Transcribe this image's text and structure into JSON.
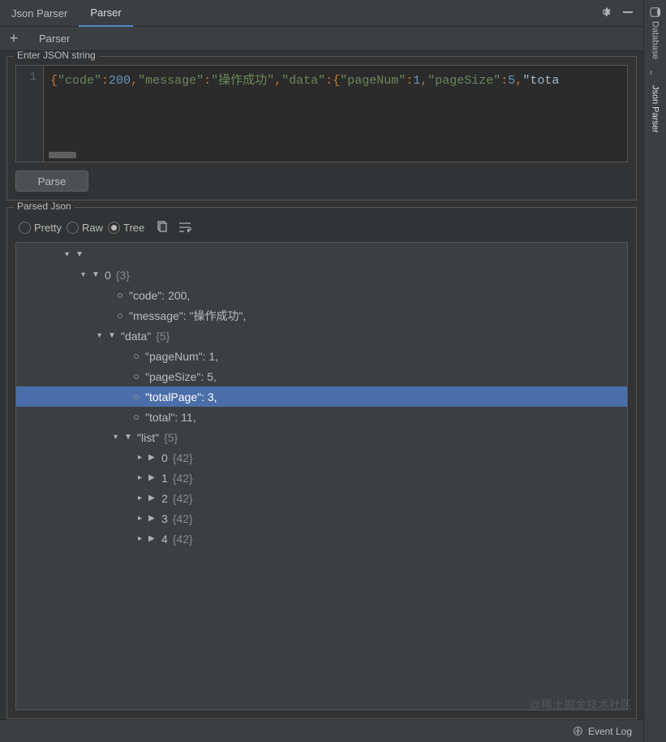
{
  "topbar": {
    "tab_inactive": "Json Parser",
    "tab_active": "Parser"
  },
  "subbar": {
    "plus": "+",
    "tab": "Parser"
  },
  "editor": {
    "fieldset_label": "Enter JSON string",
    "line_number": "1",
    "raw_json": "{\"code\":200,\"message\":\"操作成功\",\"data\":{\"pageNum\":1,\"pageSize\":5,\"tota",
    "parse_button": "Parse"
  },
  "parsed": {
    "fieldset_label": "Parsed Json",
    "view_pretty": "Pretty",
    "view_raw": "Raw",
    "view_tree": "Tree",
    "selected_view": "Tree"
  },
  "tree": [
    {
      "indent": 60,
      "type": "toggle",
      "key": "",
      "count": ""
    },
    {
      "indent": 80,
      "type": "toggle",
      "key": "0",
      "count": "{3}"
    },
    {
      "indent": 125,
      "type": "leaf",
      "key": "\"code\": 200,"
    },
    {
      "indent": 125,
      "type": "leaf",
      "key": "\"message\": \"操作成功\","
    },
    {
      "indent": 100,
      "type": "toggle",
      "key": "\"data\"",
      "count": "{5}"
    },
    {
      "indent": 145,
      "type": "leaf",
      "key": "\"pageNum\": 1,"
    },
    {
      "indent": 145,
      "type": "leaf",
      "key": "\"pageSize\": 5,"
    },
    {
      "indent": 145,
      "type": "leaf",
      "key": "\"totalPage\": 3,",
      "selected": true
    },
    {
      "indent": 145,
      "type": "leaf",
      "key": "\"total\": 11,"
    },
    {
      "indent": 120,
      "type": "toggle",
      "key": "\"list\"",
      "count": "{5}"
    },
    {
      "indent": 150,
      "type": "collapsed",
      "key": "0",
      "count": "{42}"
    },
    {
      "indent": 150,
      "type": "collapsed",
      "key": "1",
      "count": "{42}"
    },
    {
      "indent": 150,
      "type": "collapsed",
      "key": "2",
      "count": "{42}"
    },
    {
      "indent": 150,
      "type": "collapsed",
      "key": "3",
      "count": "{42}"
    },
    {
      "indent": 150,
      "type": "collapsed",
      "key": "4",
      "count": "{42}"
    }
  ],
  "rightbar": {
    "database": "Database",
    "jsonparser": "Json Parser"
  },
  "statusbar": {
    "event_log": "Event Log"
  },
  "watermark": "@稀土掘金技术社区"
}
